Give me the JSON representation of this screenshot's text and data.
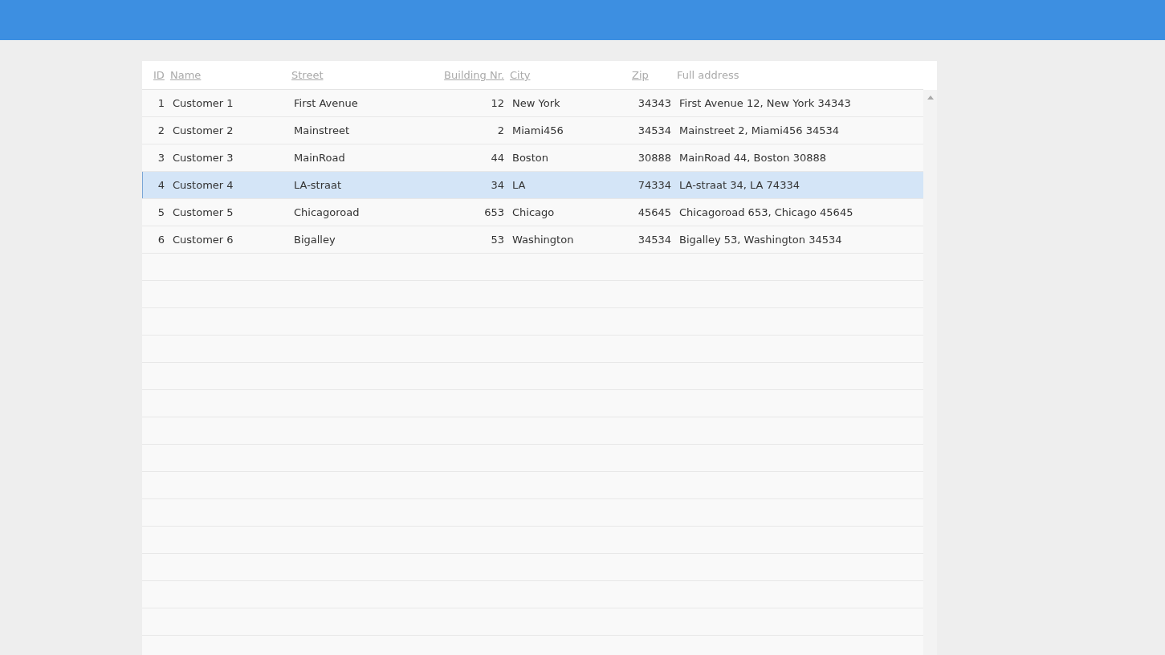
{
  "table": {
    "columns": [
      {
        "label": "ID",
        "sortable": true
      },
      {
        "label": "Name",
        "sortable": true
      },
      {
        "label": "Street",
        "sortable": true
      },
      {
        "label": "Building Nr.",
        "sortable": true
      },
      {
        "label": "City",
        "sortable": true
      },
      {
        "label": "Zip",
        "sortable": true
      },
      {
        "label": "Full address",
        "sortable": false
      }
    ],
    "rows": [
      {
        "selected": false,
        "cells": [
          "1",
          "Customer 1",
          "First Avenue",
          "12",
          "New York",
          "34343",
          "First Avenue 12, New York 34343"
        ]
      },
      {
        "selected": false,
        "cells": [
          "2",
          "Customer 2",
          "Mainstreet",
          "2",
          "Miami456",
          "34534",
          "Mainstreet 2, Miami456 34534"
        ]
      },
      {
        "selected": false,
        "cells": [
          "3",
          "Customer 3",
          "MainRoad",
          "44",
          "Boston",
          "30888",
          "MainRoad 44, Boston 30888"
        ]
      },
      {
        "selected": true,
        "cells": [
          "4",
          "Customer 4",
          "LA-straat",
          "34",
          "LA",
          "74334",
          "LA-straat 34, LA 74334"
        ]
      },
      {
        "selected": false,
        "cells": [
          "5",
          "Customer 5",
          "Chicagoroad",
          "653",
          "Chicago",
          "45645",
          "Chicagoroad 653, Chicago 45645"
        ]
      },
      {
        "selected": false,
        "cells": [
          "6",
          "Customer 6",
          "Bigalley",
          "53",
          "Washington",
          "34534",
          "Bigalley 53, Washington 34534"
        ]
      }
    ]
  }
}
